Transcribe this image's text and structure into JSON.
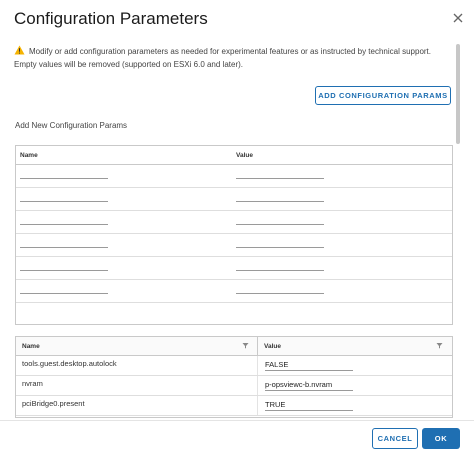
{
  "dialog": {
    "title": "Configuration Parameters",
    "warning": "Modify or add configuration parameters as needed for experimental features or as instructed by technical support. Empty values will be removed (supported on ESXi 6.0 and later).",
    "add_button": "ADD CONFIGURATION PARAMS",
    "new_params_heading": "Add New Configuration Params"
  },
  "new_params_grid": {
    "columns": [
      "Name",
      "Value"
    ],
    "rows": [
      {
        "name": "",
        "value": ""
      },
      {
        "name": "",
        "value": ""
      },
      {
        "name": "",
        "value": ""
      },
      {
        "name": "",
        "value": ""
      },
      {
        "name": "",
        "value": ""
      },
      {
        "name": "",
        "value": ""
      }
    ]
  },
  "params_grid": {
    "columns": [
      "Name",
      "Value"
    ],
    "rows": [
      {
        "name": "tools.guest.desktop.autolock",
        "value": "FALSE"
      },
      {
        "name": "nvram",
        "value": "p-opsviewc-b.nvram"
      },
      {
        "name": "pciBridge0.present",
        "value": "TRUE"
      }
    ]
  },
  "footer": {
    "cancel": "CANCEL",
    "ok": "OK"
  },
  "colors": {
    "accent": "#1f6fb2",
    "warning": "#f5b301"
  }
}
